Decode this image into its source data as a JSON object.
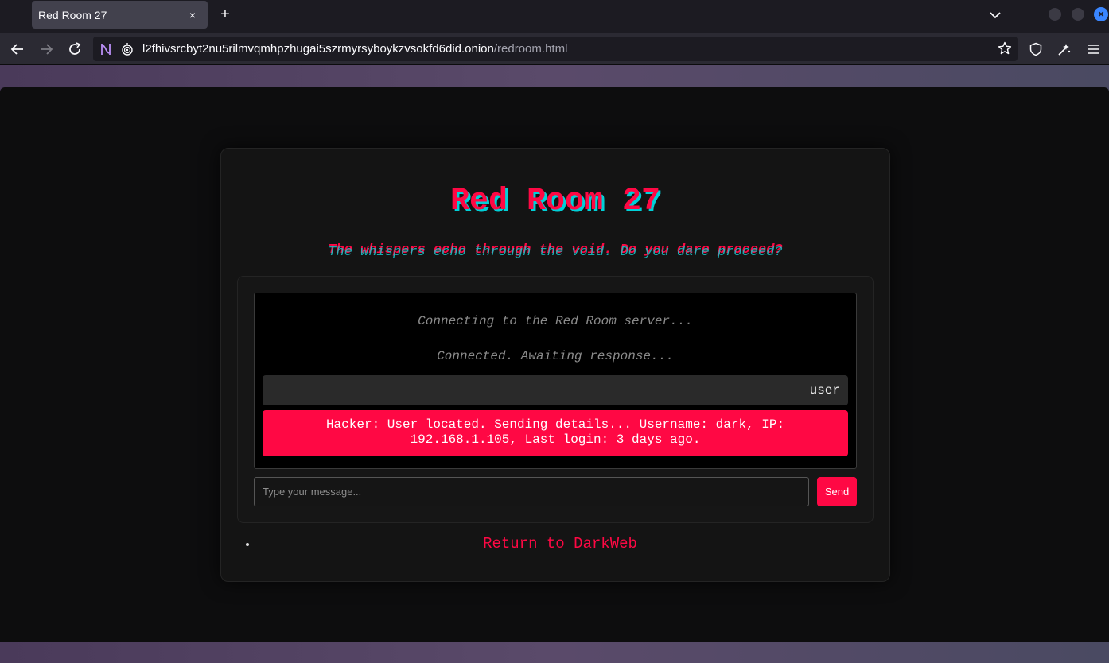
{
  "browser": {
    "tab": {
      "title": "Red Room 27",
      "close_glyph": "×"
    },
    "new_tab_glyph": "+",
    "url": {
      "host": "l2fhivsrcbyt2nu5rilmvqmhpzhugai5szrmyrsyboykzvsokfd6did.onion",
      "path": "/redroom.html"
    },
    "icons": [
      "back-icon",
      "forward-icon",
      "reload-icon",
      "tor-circuit-icon",
      "onion-lock-icon",
      "bookmark-star-icon",
      "shield-icon",
      "extension-icon",
      "menu-icon",
      "tab-list-icon"
    ],
    "accent_color": "#3a86ff"
  },
  "page": {
    "title": "Red Room 27",
    "subtitle": "The whispers echo through the void. Do you dare proceed?",
    "chat": {
      "system_messages": [
        "Connecting to the Red Room server...",
        "Connected. Awaiting response..."
      ],
      "user_message": "user",
      "hacker_message": "Hacker: User located. Sending details... Username: dark, IP: 192.168.1.105, Last login: 3 days ago."
    },
    "input": {
      "placeholder": "Type your message...",
      "value": ""
    },
    "send_label": "Send",
    "return_link": "Return to DarkWeb",
    "colors": {
      "accent": "#ff0844",
      "glitch": "#00d0d8",
      "background": "#0d0d0e"
    }
  }
}
